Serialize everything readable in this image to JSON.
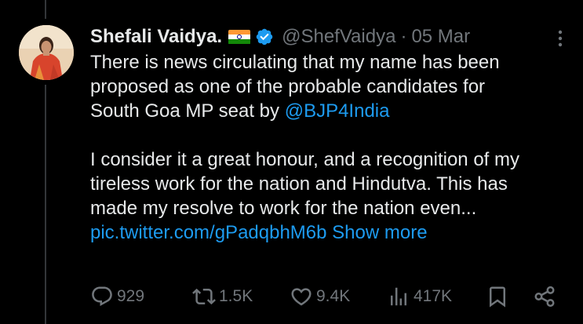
{
  "tweet": {
    "author_name": "Shefali Vaidya.",
    "author_flag": "India flag",
    "verified": true,
    "handle": "@ShefVaidya",
    "separator": "·",
    "date": "05 Mar",
    "text_line_1": "There is news circulating that my name has been",
    "text_line_2": "proposed as one of the probable candidates for",
    "text_line_3_prefix": "South Goa MP seat by ",
    "mention": "@BJP4India",
    "text_line_4": "I consider it a great honour, and a recognition of my",
    "text_line_5": "tireless work for the nation and Hindutva. This has",
    "text_line_6": "made my resolve to work for the nation even...",
    "media_link": "pic.twitter.com/gPadqbhM6b",
    "show_more": "Show more"
  },
  "actions": {
    "replies": "929",
    "retweets": "1.5K",
    "likes": "9.4K",
    "views": "417K"
  },
  "icons": {
    "verified": "verified-badge-icon",
    "more": "more-dots-icon",
    "reply": "reply-icon",
    "retweet": "retweet-icon",
    "like": "heart-icon",
    "views": "views-icon",
    "bookmark": "bookmark-icon",
    "share": "share-icon"
  },
  "colors": {
    "background": "#000000",
    "text": "#e7e9ea",
    "secondary": "#71767b",
    "link": "#1d9bf0",
    "verified": "#1d9bf0"
  }
}
